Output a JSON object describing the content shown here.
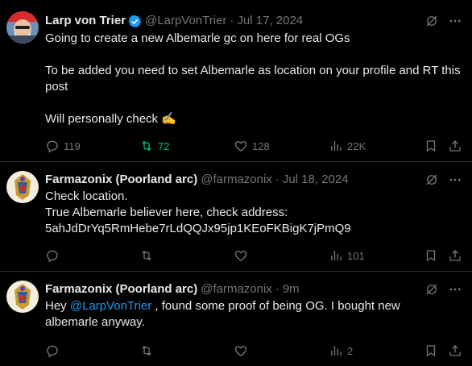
{
  "tweets": [
    {
      "name": "Larp von Trier",
      "verified": true,
      "handle": "@LarpVonTrier",
      "dot": "·",
      "time": "Jul 17, 2024",
      "text": "Going to create a new Albemarle gc on here for real OGs\n\nTo be added you need to set Albemarle as location on your profile and RT this post\n\nWill personally check ✍️",
      "replies": "119",
      "reposts": "72",
      "likes": "128",
      "views": "22K",
      "reposted": true
    },
    {
      "name": "Farmazonix (Poorland arc)",
      "handle": "@farmazonix",
      "dot": "·",
      "time": "Jul 18, 2024",
      "text": "Check location.\nTrue Albemarle believer here, check address:\n5ahJdDrYq5RmHebe7rLdQQJx95jp1KEoFKBigK7jPmQ9",
      "replies": "",
      "reposts": "",
      "likes": "",
      "views": "101"
    },
    {
      "name": "Farmazonix (Poorland arc)",
      "handle": "@farmazonix",
      "dot": "·",
      "time": "9m",
      "text_prefix": "Hey ",
      "mention": "@LarpVonTrier",
      "text_suffix": " , found some proof of being OG. I bought new albemarle anyway.",
      "replies": "",
      "reposts": "",
      "likes": "",
      "views": "2"
    }
  ],
  "colors": {
    "background": "#000000",
    "text": "#e7e9ea",
    "muted": "#71767b",
    "accent": "#1d9bf0",
    "repost_active": "#00ba7c",
    "separator": "#2f3336"
  }
}
